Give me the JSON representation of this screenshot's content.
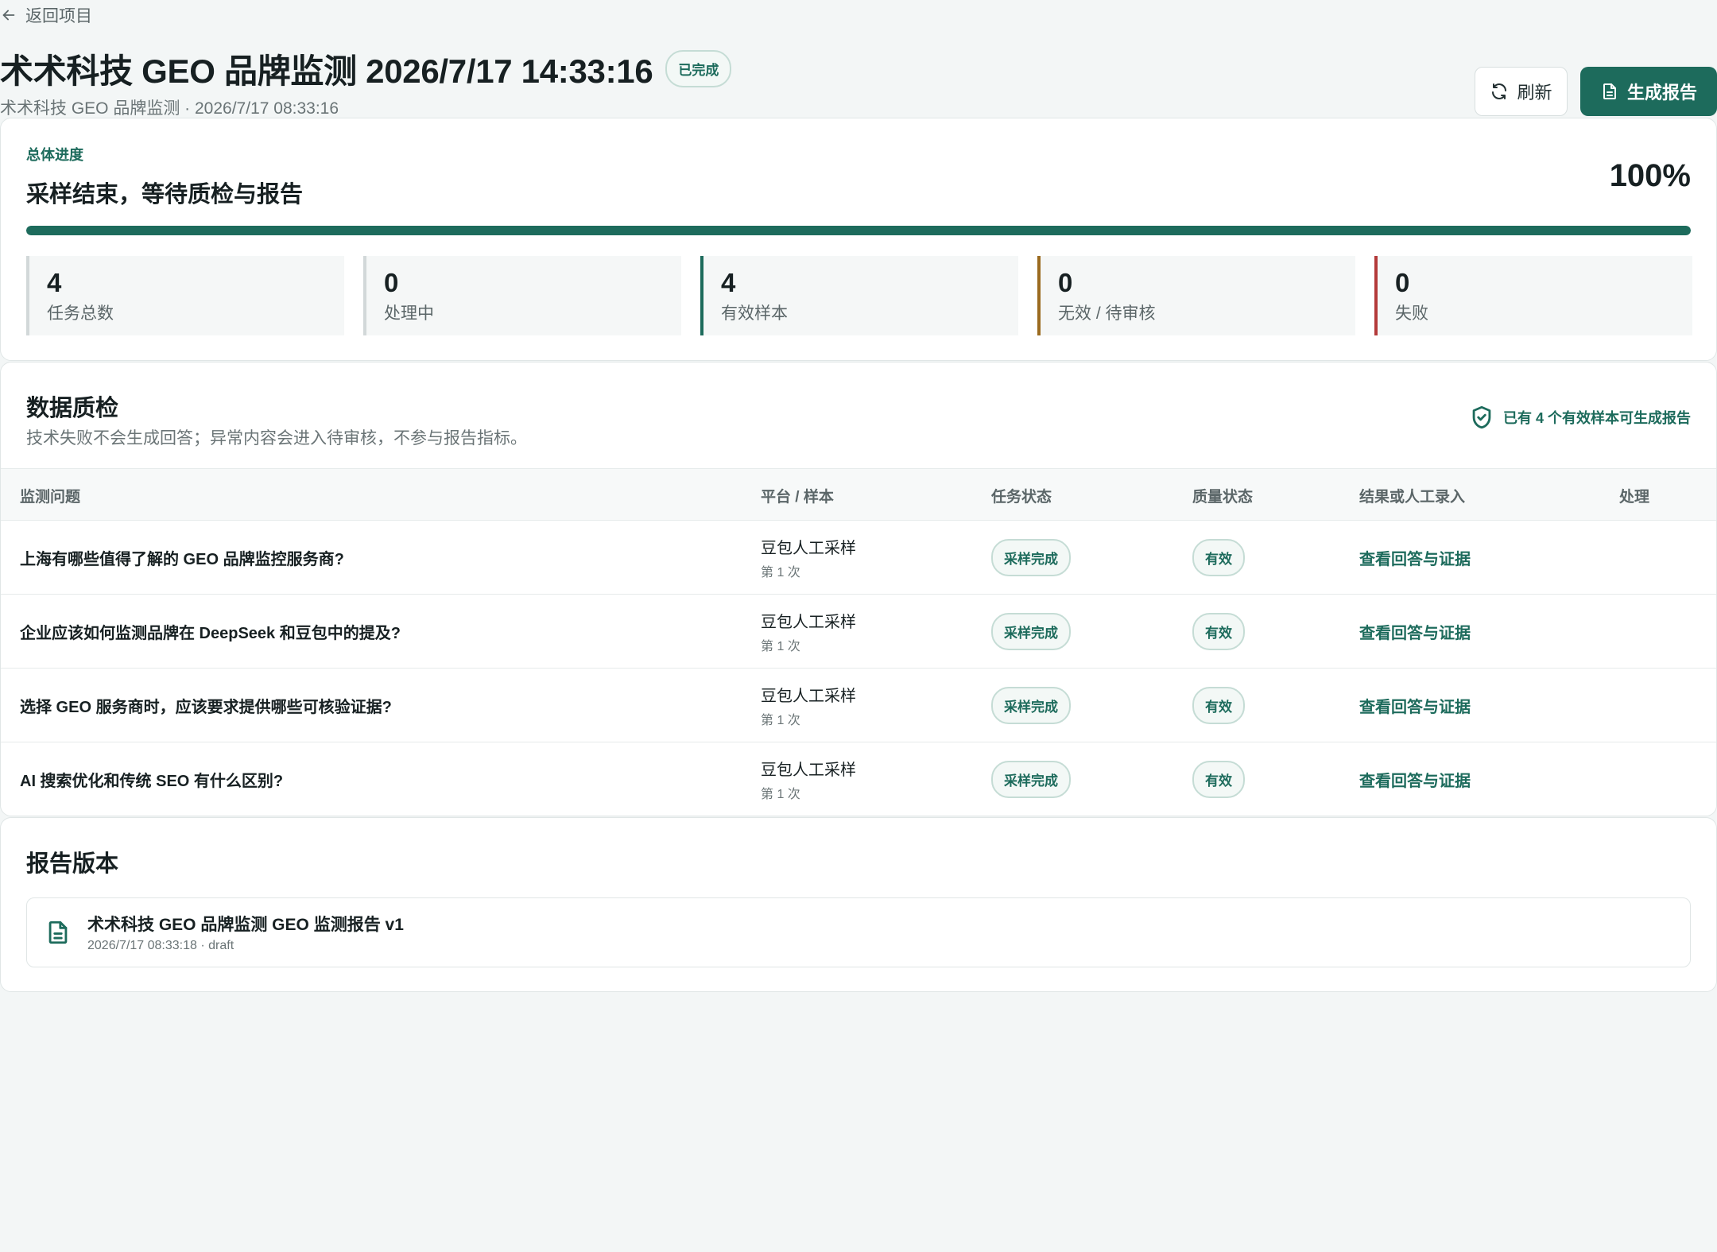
{
  "nav": {
    "back_label": "返回项目"
  },
  "header": {
    "title": "术术科技 GEO 品牌监测 2026/7/17 14:33:16",
    "status": "已完成",
    "subtitle": "术术科技 GEO 品牌监测 · 2026/7/17 08:33:16",
    "refresh_label": "刷新",
    "generate_label": "生成报告"
  },
  "progress": {
    "label": "总体进度",
    "heading": "采样结束，等待质检与报告",
    "percent_text": "100%",
    "percent": 100,
    "stats": [
      {
        "value": "4",
        "label": "任务总数"
      },
      {
        "value": "0",
        "label": "处理中"
      },
      {
        "value": "4",
        "label": "有效样本"
      },
      {
        "value": "0",
        "label": "无效 / 待审核"
      },
      {
        "value": "0",
        "label": "失败"
      }
    ]
  },
  "quality": {
    "title": "数据质检",
    "description": "技术失败不会生成回答；异常内容会进入待审核，不参与报告指标。",
    "note": "已有 4 个有效样本可生成报告",
    "columns": [
      "监测问题",
      "平台 / 样本",
      "任务状态",
      "质量状态",
      "结果或人工录入",
      "处理"
    ],
    "rows": [
      {
        "question": "上海有哪些值得了解的 GEO 品牌监控服务商?",
        "platform": "豆包人工采样",
        "sample": "第 1 次",
        "task_status": "采样完成",
        "quality_status": "有效",
        "result": "查看回答与证据"
      },
      {
        "question": "企业应该如何监测品牌在 DeepSeek 和豆包中的提及?",
        "platform": "豆包人工采样",
        "sample": "第 1 次",
        "task_status": "采样完成",
        "quality_status": "有效",
        "result": "查看回答与证据"
      },
      {
        "question": "选择 GEO 服务商时，应该要求提供哪些可核验证据?",
        "platform": "豆包人工采样",
        "sample": "第 1 次",
        "task_status": "采样完成",
        "quality_status": "有效",
        "result": "查看回答与证据"
      },
      {
        "question": "AI 搜索优化和传统 SEO 有什么区别?",
        "platform": "豆包人工采样",
        "sample": "第 1 次",
        "task_status": "采样完成",
        "quality_status": "有效",
        "result": "查看回答与证据"
      }
    ]
  },
  "reports": {
    "title": "报告版本",
    "items": [
      {
        "name": "术术科技 GEO 品牌监测 GEO 监测报告 v1",
        "meta": "2026/7/17 08:33:18 · draft"
      }
    ]
  }
}
